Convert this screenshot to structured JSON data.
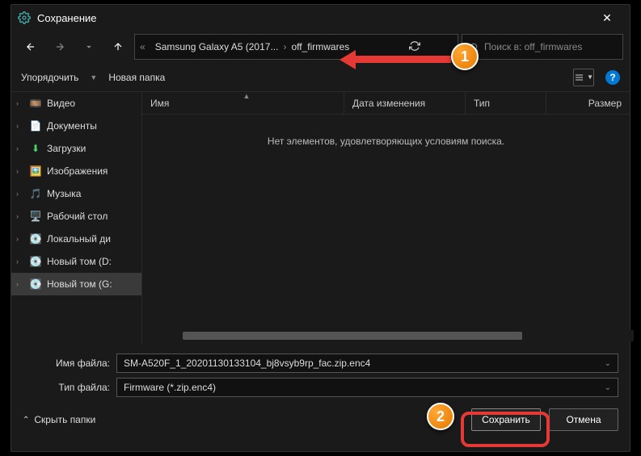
{
  "title": "Сохранение",
  "breadcrumb": {
    "chev": "«",
    "p1": "Samsung Galaxy A5 (2017...",
    "p2": "off_firmwares"
  },
  "search": {
    "placeholder": "Поиск в: off_firmwares"
  },
  "toolbar": {
    "organize": "Упорядочить",
    "newfolder": "Новая папка"
  },
  "sidebar": [
    {
      "icon": "🎞️",
      "label": "Видео"
    },
    {
      "icon": "📄",
      "label": "Документы"
    },
    {
      "icon": "⬇",
      "label": "Загрузки",
      "iconColor": "#4fd66b"
    },
    {
      "icon": "🖼️",
      "label": "Изображения"
    },
    {
      "icon": "🎵",
      "label": "Музыка",
      "iconColor": "#ff5a9e"
    },
    {
      "icon": "🖥️",
      "label": "Рабочий стол"
    },
    {
      "icon": "💽",
      "label": "Локальный ди"
    },
    {
      "icon": "💽",
      "label": "Новый том (D:"
    },
    {
      "icon": "💽",
      "label": "Новый том (G:",
      "selected": true
    }
  ],
  "columns": {
    "name": "Имя",
    "date": "Дата изменения",
    "type": "Тип",
    "size": "Размер"
  },
  "empty_msg": "Нет элементов, удовлетворяющих условиям поиска.",
  "filename_label": "Имя файла:",
  "filetype_label": "Тип файла:",
  "filename": "SM-A520F_1_20201130133104_bj8vsyb9rp_fac.zip.enc4",
  "filetype": "Firmware (*.zip.enc4)",
  "hide_folders": "Скрыть папки",
  "save": "Сохранить",
  "cancel": "Отмена",
  "badges": {
    "one": "1",
    "two": "2"
  }
}
